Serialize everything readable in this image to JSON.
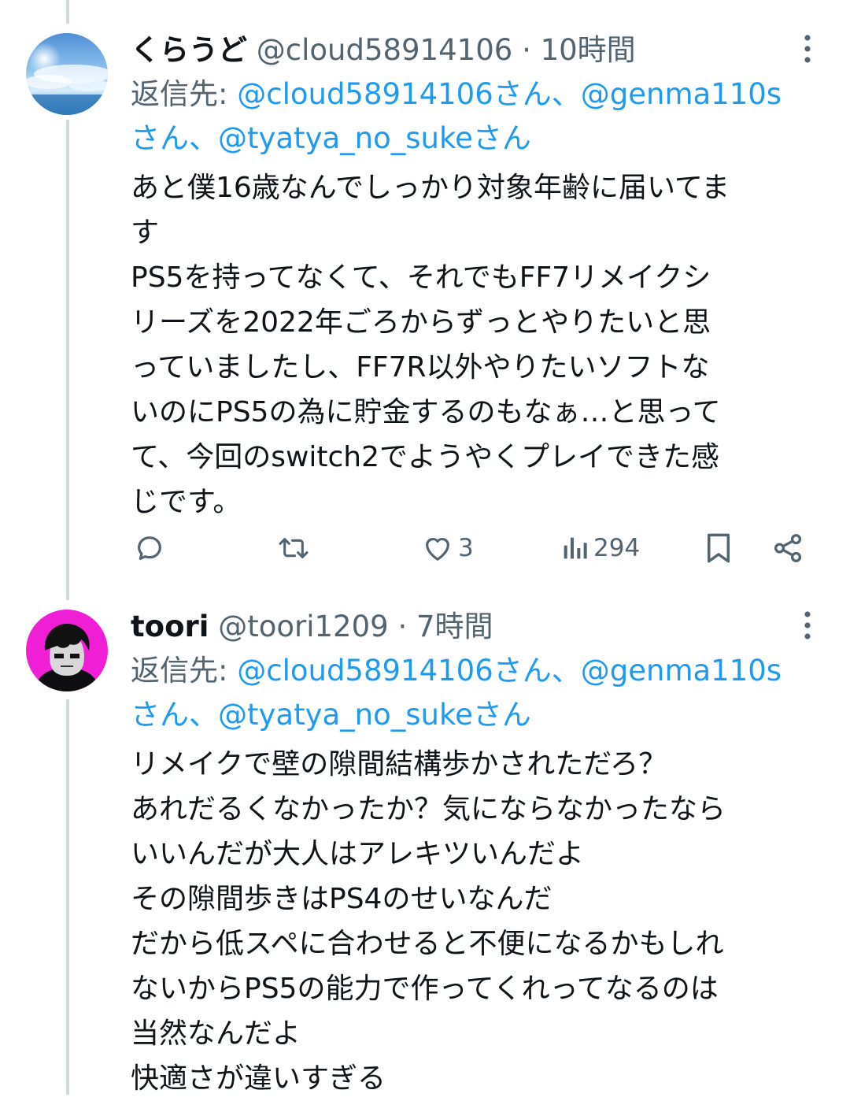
{
  "tweets": [
    {
      "display_name": "くらうど",
      "handle": "@cloud58914106",
      "separator": "·",
      "time": "10時間",
      "reply_prefix": "返信先: ",
      "reply_mention_1": "@cloud58914106さん",
      "reply_sep_1": "、",
      "reply_mention_2": "@genma110s",
      "reply_mention_2_cont": "さん",
      "reply_sep_2": "、",
      "reply_mention_3": "@tyatya_no_sukeさん",
      "body_lines": [
        "あと僕16歳なんでしっかり対象年齢に届いてま",
        "す",
        "PS5を持ってなくて、それでもFF7リメイクシ",
        "リーズを2022年ごろからずっとやりたいと思",
        "っていましたし、FF7R以外やりたいソフトな",
        "いのにPS5の為に貯金するのもなぁ…と思って",
        "て、今回のswitch2でようやくプレイできた感",
        "じです。"
      ],
      "actions": {
        "reply_icon": "reply-icon",
        "retweet_icon": "retweet-icon",
        "like_icon": "heart-icon",
        "like_count": "3",
        "views_icon": "views-icon",
        "views_count": "294",
        "bookmark_icon": "bookmark-icon",
        "share_icon": "share-icon"
      }
    },
    {
      "display_name": "toori",
      "handle": "@toori1209",
      "separator": "·",
      "time": "7時間",
      "reply_prefix": "返信先: ",
      "reply_mention_1": "@cloud58914106さん",
      "reply_sep_1": "、",
      "reply_mention_2": "@genma110s",
      "reply_mention_2_cont": "さん",
      "reply_sep_2": "、",
      "reply_mention_3": "@tyatya_no_sukeさん",
      "body_lines": [
        "リメイクで壁の隙間結構歩かされただろ？",
        "あれだるくなかったか？気にならなかったなら",
        "いいんだが大人はアレキツいんだよ",
        "その隙間歩きはPS4のせいなんだ",
        "だから低スペに合わせると不便になるかもしれ",
        "ないからPS5の能力で作ってくれってなるのは",
        "当然なんだよ",
        "快適さが違いすぎる"
      ]
    }
  ],
  "colors": {
    "link": "#1d9bf0",
    "secondary_text": "#536471",
    "thread_line": "#cfd9de",
    "avatar2_bg": "#f01fd6"
  }
}
